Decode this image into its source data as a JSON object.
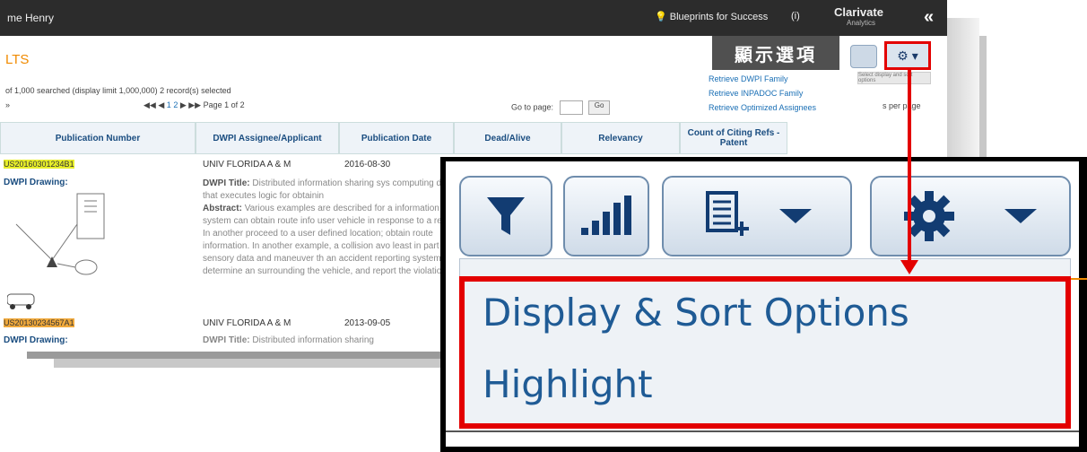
{
  "topbar": {
    "user": "me Henry",
    "blueprints": "Blueprints for Success",
    "help": "(i)",
    "brand": "Clarivate",
    "brand_sub": "Analytics",
    "collapse": "«"
  },
  "results": {
    "title": "LTS",
    "searched": "of 1,000 searched (display limit 1,000,000)    2 record(s) selected",
    "arrow_left": "»",
    "pager_prefix": "◀◀ ◀",
    "pager_num1": "1",
    "pager_num2": "2",
    "pager_suffix": "▶ ▶▶  Page 1 of 2",
    "goto_label": "Go to page:",
    "goto_button": "Go",
    "perpage": "s per page"
  },
  "table": {
    "headers": [
      "Publication Number",
      "DWPI Assignee/Applicant",
      "Publication Date",
      "Dead/Alive",
      "Relevancy",
      "Count of Citing Refs - Patent"
    ],
    "row1": {
      "pub": "US20160301234B1",
      "assignee": "UNIV FLORIDA A & M",
      "date": "2016-08-30",
      "drawing_label": "DWPI Drawing:",
      "title_label": "DWPI Title:",
      "title_text": "Distributed information sharing sys computing device that executes logic for obtainin",
      "abstract_label": "Abstract:",
      "abstract_text": "Various examples are described for a information sharing system can obtain route info user vehicle in response to a request. In another proceed to a user defined location; obtain route information. In another example, a collision avo least in part upon sensory data and maneuver th an accident reporting system can determine an surrounding the vehicle, and report the violation"
    },
    "row2": {
      "pub": "US20130234567A1",
      "assignee": "UNIV FLORIDA A & M",
      "date": "2013-09-05",
      "drawing_label": "DWPI Drawing:",
      "title_label": "DWPI Title:",
      "title_text": "Distributed information sharing"
    }
  },
  "callout": {
    "label": "顯示選項",
    "mini_menu": [
      "Retrieve DWPI Family",
      "Retrieve INPADOC Family",
      "Retrieve Optimized Assignees"
    ],
    "mini_tip": "Select display and sort options"
  },
  "zoom": {
    "menu_items": [
      "Display & Sort Options",
      "Highlight"
    ]
  },
  "colors": {
    "accent_red": "#e30000",
    "link_blue": "#1f5b95",
    "orange": "#f08a00"
  }
}
